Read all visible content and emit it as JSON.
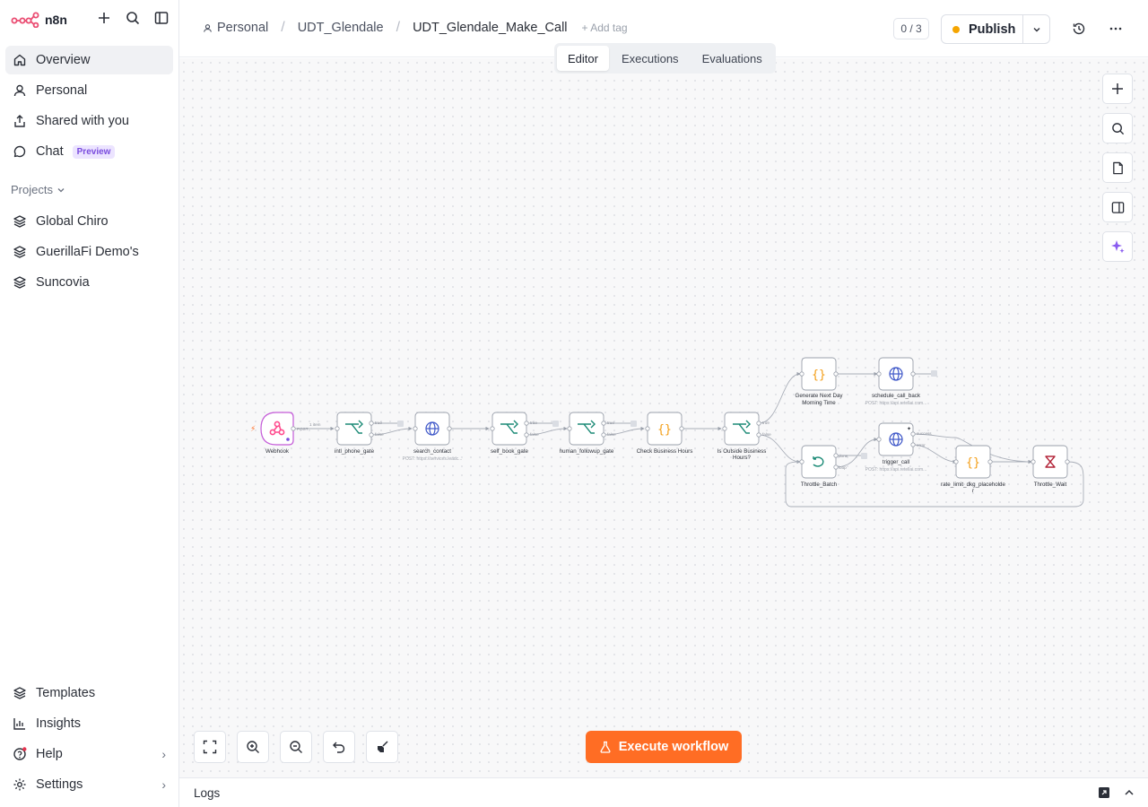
{
  "app": {
    "name": "n8n"
  },
  "sidebar": {
    "nav": [
      {
        "label": "Overview"
      },
      {
        "label": "Personal"
      },
      {
        "label": "Shared with you"
      },
      {
        "label": "Chat",
        "badge": "Preview"
      }
    ],
    "projects_label": "Projects",
    "projects": [
      {
        "label": "Global Chiro"
      },
      {
        "label": "GuerillaFi Demo's"
      },
      {
        "label": "Suncovia"
      }
    ],
    "bottom": [
      {
        "label": "Templates"
      },
      {
        "label": "Insights"
      },
      {
        "label": "Help"
      },
      {
        "label": "Settings"
      }
    ]
  },
  "header": {
    "breadcrumb": [
      "Personal",
      "UDT_Glendale",
      "UDT_Glendale_Make_Call"
    ],
    "add_tag": "+ Add tag",
    "counter": "0 / 3",
    "publish_label": "Publish"
  },
  "tabs": [
    {
      "label": "Editor",
      "active": true
    },
    {
      "label": "Executions",
      "active": false
    },
    {
      "label": "Evaluations",
      "active": false
    }
  ],
  "workflow": {
    "nodes": {
      "webhook": "Webhook",
      "intl_phone_gate": "intl_phone_gate",
      "search_contact": "search_contact",
      "search_contact_sub": "POST: https://services.leadc...",
      "self_book_gate": "self_book_gate",
      "human_followup_gate": "human_followup_gate",
      "check_business_hours": "Check Business Hours",
      "is_outside_line1": "Is Outside Business",
      "is_outside_line2": "Hours?",
      "gen_next_line1": "Generate Next Day",
      "gen_next_line2": "Morning Time",
      "schedule_call_back": "schedule_call_back",
      "schedule_sub": "POST: https://api.retellai.com...",
      "throttle_batch": "Throttle_Batch",
      "trigger_call": "trigger_call",
      "trigger_sub": "POST: https://api.retellai.com...",
      "rate_limit_line1": "rate_limit_dkg_placeholde",
      "rate_limit_line2": "r",
      "throttle_wait": "Throttle_Wait"
    },
    "edge_labels": {
      "webhook_items": "1 item",
      "post": "POST",
      "true": "true",
      "false": "false",
      "done": "done",
      "loop": "loop",
      "success": "success",
      "error": "error"
    }
  },
  "canvas": {
    "execute_label": "Execute workflow"
  },
  "logs": {
    "label": "Logs"
  },
  "colors": {
    "accent": "#ff6d24",
    "publish_dot": "#f5a500",
    "webhook": "#ff4a8d"
  }
}
